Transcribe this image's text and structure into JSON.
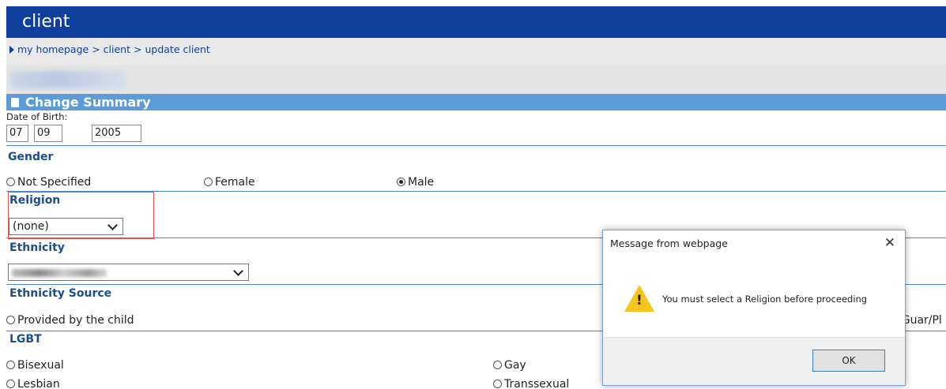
{
  "header": {
    "title": "client"
  },
  "breadcrumb": {
    "home": "my homepage",
    "sep1": ">",
    "client": "client",
    "sep2": ">",
    "current": "update client"
  },
  "section": {
    "title": "Change Summary"
  },
  "dob": {
    "label": "Date of Birth:",
    "day": "07",
    "month": "09",
    "year": "2005"
  },
  "gender": {
    "label": "Gender",
    "options": [
      "Not Specified",
      "Female",
      "Male"
    ],
    "selected": "Male"
  },
  "religion": {
    "label": "Religion",
    "value": "(none)"
  },
  "ethnicity": {
    "label": "Ethnicity"
  },
  "ethnicity_source": {
    "label": "Ethnicity Source",
    "option1": "Provided by the child",
    "option_partial": "/Guar/Pl"
  },
  "lgbt": {
    "label": "LGBT",
    "options": [
      "Bisexual",
      "Gay",
      "Lesbian",
      "Transsexual"
    ]
  },
  "dialog": {
    "title": "Message from webpage",
    "close": "✕",
    "message": "You must select a Religion before proceeding",
    "warn_glyph": "!",
    "ok": "OK"
  },
  "colors": {
    "header_bg": "#0e3f9c",
    "section_bg": "#5a9bd8",
    "label_color": "#1a4f8f",
    "highlight_border": "#d9534f",
    "warning": "#f7c51e"
  }
}
